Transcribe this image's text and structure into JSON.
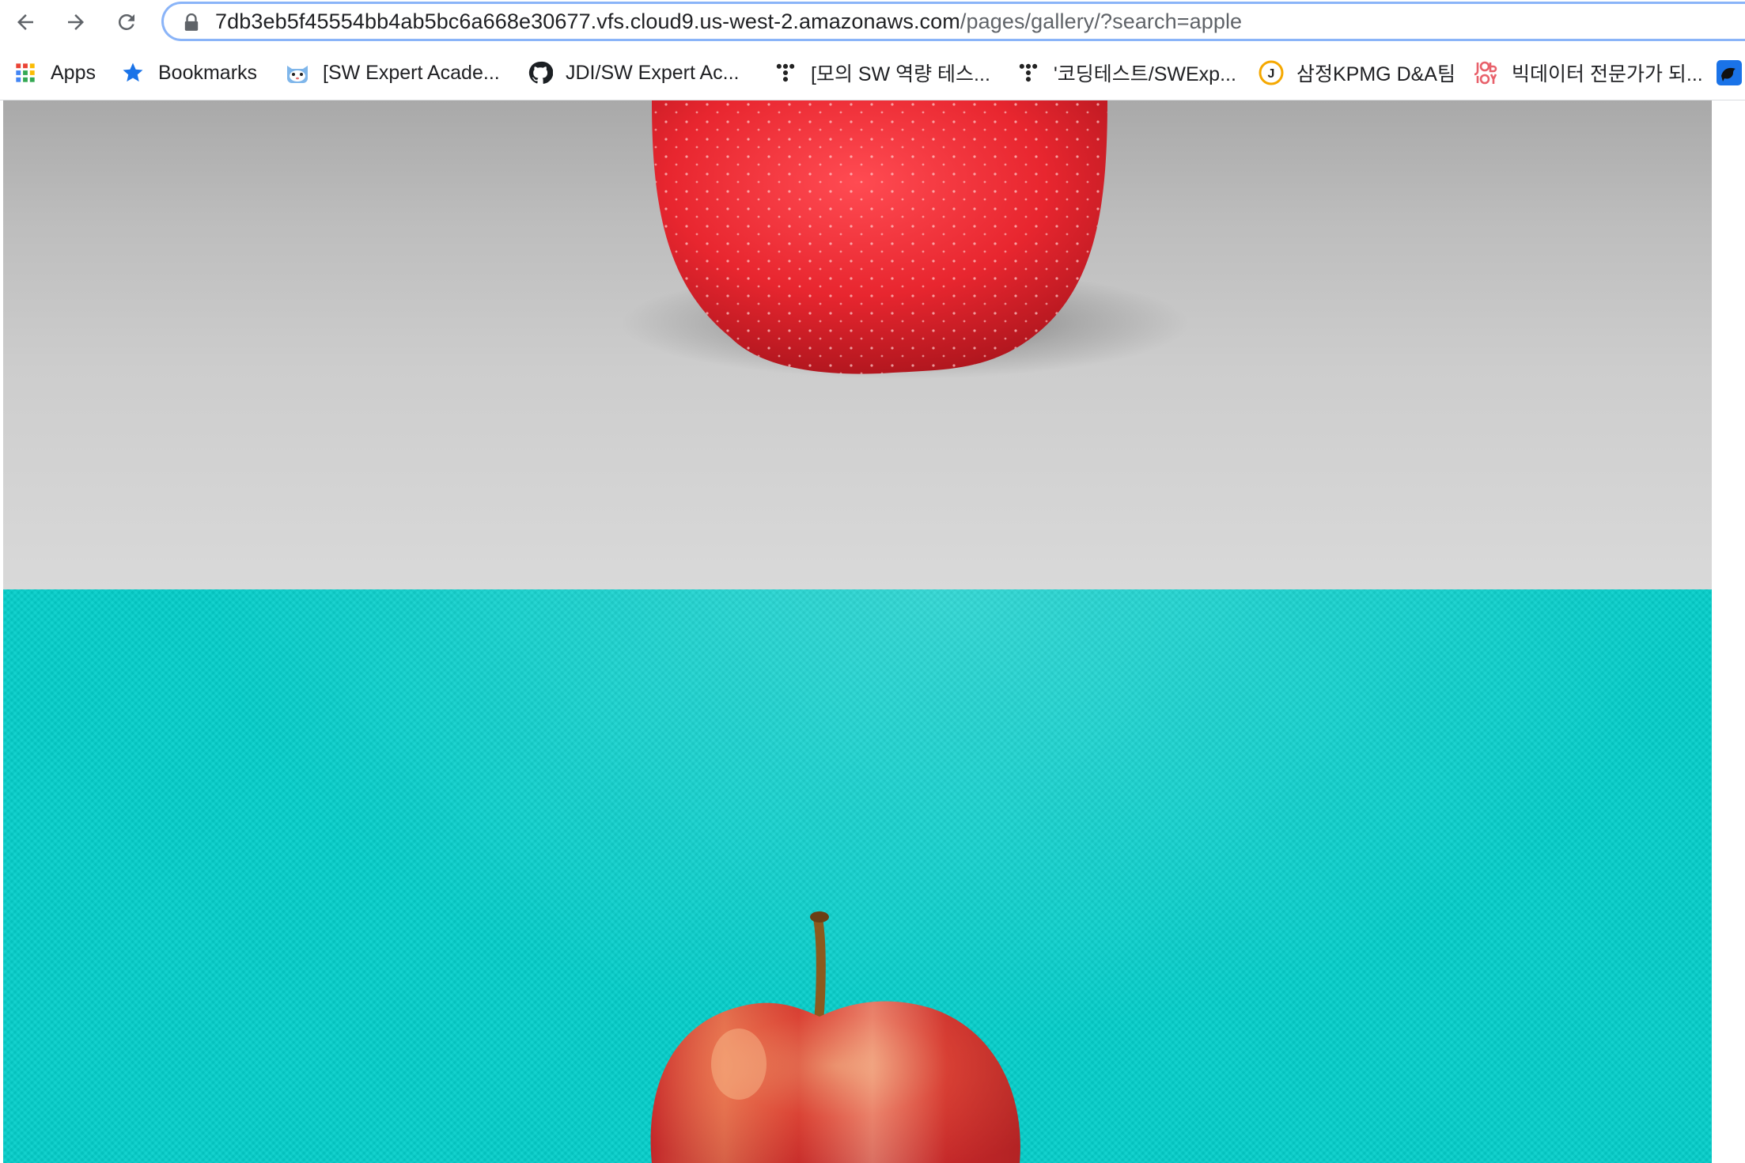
{
  "browser": {
    "url_host": "7db3eb5f45554bb4ab5bc6a668e30677.vfs.cloud9.us-west-2.amazonaws.com",
    "url_path": "/pages/gallery/?search=apple"
  },
  "bookmarks": [
    {
      "label": "Apps",
      "icon": "apps-grid-icon"
    },
    {
      "label": "Bookmarks",
      "icon": "star-icon"
    },
    {
      "label": "[SW Expert Acade...",
      "icon": "swea-cat-icon"
    },
    {
      "label": "JDI/SW Expert Ac...",
      "icon": "github-icon"
    },
    {
      "label": "[모의 SW 역량 테스...",
      "icon": "tistory-icon"
    },
    {
      "label": "'코딩테스트/SWExp...",
      "icon": "tistory-icon"
    },
    {
      "label": "삼정KPMG D&A팀",
      "icon": "jobkorea-j-icon"
    },
    {
      "label": "빅데이터 전문가가 되...",
      "icon": "job-logo-icon"
    },
    {
      "label": "",
      "icon": "bird-icon"
    }
  ],
  "gallery": {
    "search_query": "apple",
    "images": [
      {
        "subject": "red apple on grey background",
        "background_color": "#c8c8c8"
      },
      {
        "subject": "red apple with stem on teal textured background",
        "background_color": "#05cfcb"
      }
    ]
  },
  "colors": {
    "omnibox_border": "#8ab4f8",
    "star_blue": "#1a73e8",
    "apple_red": "#e52a34",
    "teal": "#05cfcb"
  }
}
